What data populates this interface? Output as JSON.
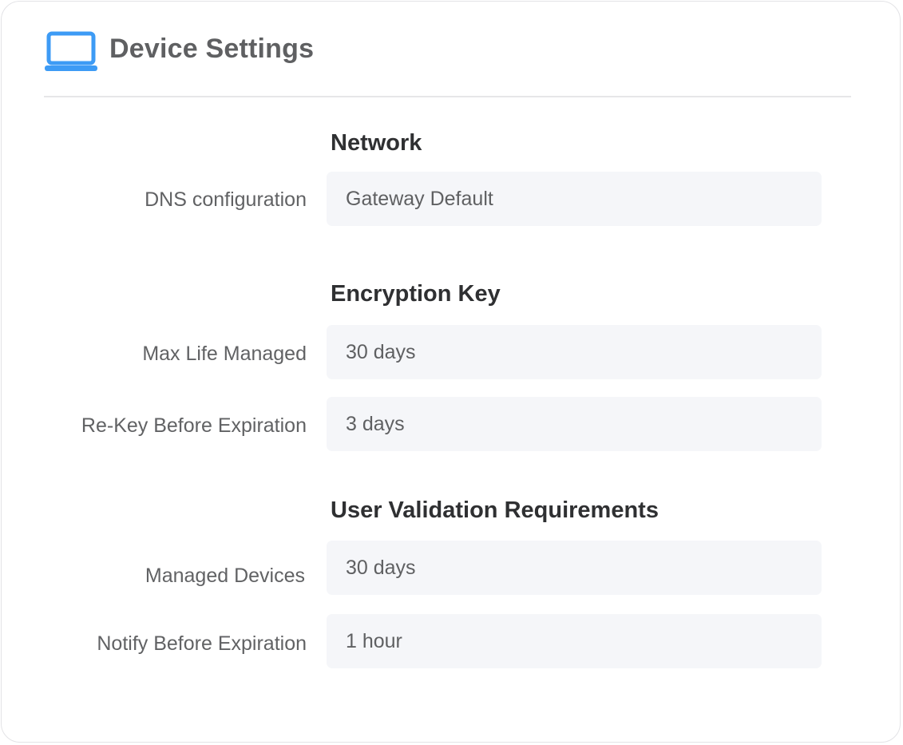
{
  "header": {
    "icon": "laptop-icon",
    "title": "Device Settings",
    "accent_color": "#3d9bf5"
  },
  "sections": [
    {
      "title": "Network",
      "rows": [
        {
          "label": "DNS configuration",
          "value": "Gateway Default"
        }
      ]
    },
    {
      "title": "Encryption Key",
      "rows": [
        {
          "label": "Max Life Managed",
          "value": "30 days"
        },
        {
          "label": "Re-Key Before Expiration",
          "value": "3 days"
        }
      ]
    },
    {
      "title": "User Validation Requirements",
      "rows": [
        {
          "label": "Managed Devices",
          "value": "30 days"
        },
        {
          "label": "Notify Before Expiration",
          "value": "1 hour"
        }
      ]
    }
  ]
}
